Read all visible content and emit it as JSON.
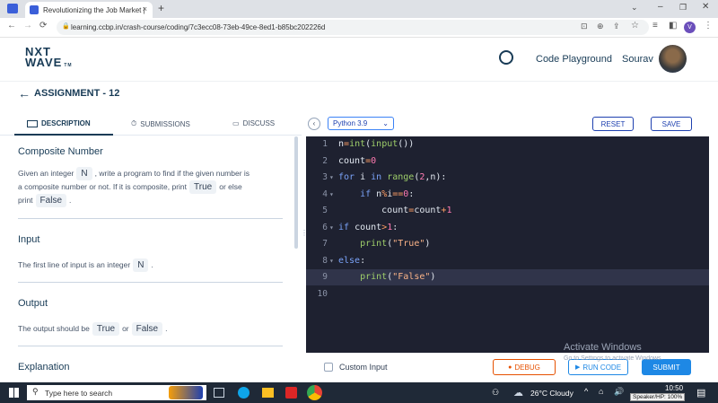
{
  "browser": {
    "tab_title": "Revolutionizing the Job Market |",
    "tab_close": "×",
    "new_tab": "+",
    "url": "learning.ccbp.in/crash-course/coding/7c3ecc08-73eb-49ce-8ed1-b85bc202226d",
    "profile_initial": "V"
  },
  "header": {
    "logo_line1": "NXT",
    "logo_line2": "WAVE",
    "logo_tm": "TM",
    "code_playground": "Code Playground",
    "user_name": "Sourav"
  },
  "assignment": {
    "title": "ASSIGNMENT - 12"
  },
  "left_tabs": [
    {
      "label": "DESCRIPTION"
    },
    {
      "label": "SUBMISSIONS"
    },
    {
      "label": "DISCUSS"
    }
  ],
  "problem": {
    "title": "Composite Number",
    "desc_1": "Given an integer",
    "chip_n": "N",
    "desc_2": ", write a program to find if the given number is",
    "desc_3": "a composite number or not. If it is composite, print",
    "chip_true": "True",
    "desc_4": "or else",
    "desc_5": "print",
    "chip_false": "False",
    "desc_6": ".",
    "input_heading": "Input",
    "input_text": "The first line of input is an integer",
    "output_heading": "Output",
    "output_text": "The output should be",
    "output_or": "or",
    "explanation_heading": "Explanation"
  },
  "editor": {
    "language": "Python 3.9",
    "reset": "RESET",
    "save": "SAVE",
    "line_numbers": [
      "1",
      "2",
      "3",
      "4",
      "5",
      "6",
      "7",
      "8",
      "9",
      "10"
    ],
    "fold_marker": "▾",
    "custom_input": "Custom Input",
    "debug": "DEBUG",
    "run_code": "RUN CODE",
    "submit": "SUBMIT"
  },
  "os": {
    "activate_title": "Activate Windows",
    "activate_sub": "Go to Settings to activate Windows.",
    "search_placeholder": "Type here to search",
    "weather": "26°C  Cloudy",
    "time": "10:50",
    "speaker": "Speaker/HP: 100%"
  },
  "colors": {
    "navy": "#183b56",
    "accent_blue": "#1e88e5",
    "debug_orange": "#e65100",
    "editor_bg": "#1e2130"
  }
}
